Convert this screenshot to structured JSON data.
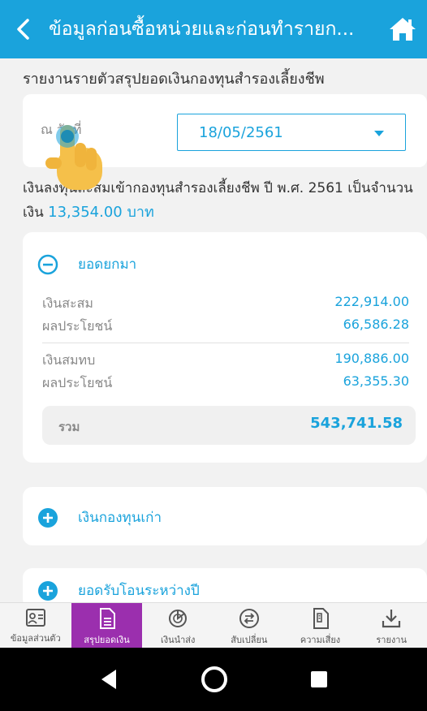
{
  "header": {
    "title": "ข้อมูลก่อนซื้อหน่วยและก่อนทำรายก...",
    "back_icon": "back-chevron-icon",
    "home_icon": "home-icon"
  },
  "subtitle": "รายงานรายตัวสรุปยอดเงินกองทุนสำรองเลี้ยงชีพ",
  "date_picker": {
    "label": "ณ วันที่",
    "value": "18/05/2561"
  },
  "info": {
    "text": "เงินลงทุนสะสมเข้ากองทุนสำรองเลี้ยงชีพ ปี พ.ศ. 2561 เป็นจำนวนเงิน",
    "amount": "13,354.00 บาท"
  },
  "carried_forward": {
    "label": "ยอดยกมา",
    "rows": [
      {
        "key": "เงินสะสม",
        "value": "222,914.00"
      },
      {
        "key": "ผลประโยชน์",
        "value": "66,586.28"
      },
      {
        "key": "เงินสมทบ",
        "value": "190,886.00"
      },
      {
        "key": "ผลประโยชน์",
        "value": "63,355.30"
      }
    ],
    "total_label": "รวม",
    "total_value": "543,741.58"
  },
  "old_fund": {
    "label": "เงินกองทุนเก่า"
  },
  "transfer": {
    "label": "ยอดรับโอนระหว่างปี"
  },
  "nav": [
    {
      "label": "ข้อมูลส่วนตัว",
      "icon": "profile-icon"
    },
    {
      "label": "สรุปยอดเงิน",
      "icon": "document-icon"
    },
    {
      "label": "เงินนำส่ง",
      "icon": "pie-chart-icon"
    },
    {
      "label": "สับเปลี่ยน",
      "icon": "switch-icon"
    },
    {
      "label": "ความเสี่ยง",
      "icon": "risk-doc-icon"
    },
    {
      "label": "รายงาน",
      "icon": "download-icon"
    }
  ],
  "colors": {
    "accent": "#1aa3dc",
    "nav_active": "#9b2fae"
  }
}
